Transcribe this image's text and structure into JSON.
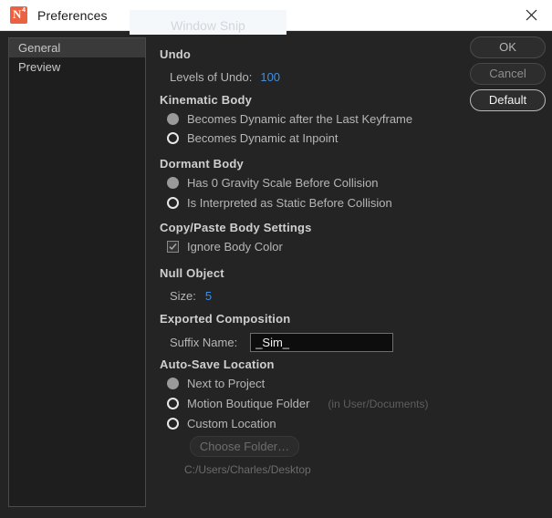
{
  "window": {
    "title": "Preferences",
    "app_icon": "newton-app-icon",
    "close_icon": "close-icon"
  },
  "overlay": {
    "label": "Window Snip"
  },
  "sidebar": {
    "items": [
      {
        "label": "General",
        "selected": true
      },
      {
        "label": "Preview",
        "selected": false
      }
    ]
  },
  "buttons": {
    "ok": "OK",
    "cancel": "Cancel",
    "default": "Default"
  },
  "sections": {
    "undo": {
      "title": "Undo",
      "levels_label": "Levels of Undo:",
      "levels_value": "100"
    },
    "kinematic_body": {
      "title": "Kinematic Body",
      "options": [
        {
          "label": "Becomes Dynamic after the Last Keyframe",
          "state": "filled"
        },
        {
          "label": "Becomes Dynamic at Inpoint",
          "state": "hollow"
        }
      ]
    },
    "dormant_body": {
      "title": "Dormant Body",
      "options": [
        {
          "label": "Has 0 Gravity Scale Before Collision",
          "state": "filled"
        },
        {
          "label": "Is Interpreted as Static Before Collision",
          "state": "hollow"
        }
      ]
    },
    "copy_paste": {
      "title": "Copy/Paste Body Settings",
      "checkbox_label": "Ignore Body Color",
      "checkbox_checked": true
    },
    "null_object": {
      "title": "Null Object",
      "size_label": "Size:",
      "size_value": "5"
    },
    "exported_composition": {
      "title": "Exported Composition",
      "suffix_label": "Suffix Name:",
      "suffix_value": "_Sim_",
      "suffix_placeholder": "_Sim_"
    },
    "auto_save": {
      "title": "Auto-Save Location",
      "options": [
        {
          "label": "Next to Project",
          "state": "filled",
          "hint": ""
        },
        {
          "label": "Motion Boutique Folder",
          "state": "hollow",
          "hint": "(in User/Documents)"
        },
        {
          "label": "Custom Location",
          "state": "hollow",
          "hint": ""
        }
      ],
      "choose_folder_label": "Choose Folder…",
      "path": "C:/Users/Charles/Desktop"
    }
  },
  "colors": {
    "accent_blue": "#3f8fe0",
    "app_icon_orange": "#ec6142",
    "window_bg": "#242424",
    "panel_bg": "#1e1e1e"
  }
}
